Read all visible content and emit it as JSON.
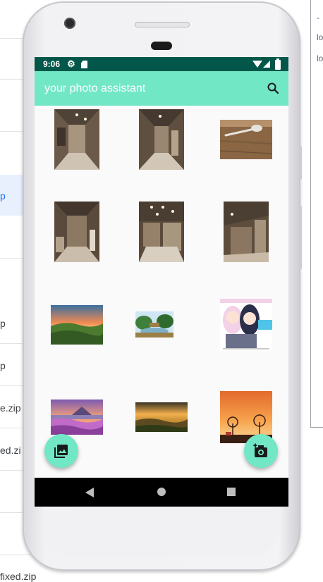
{
  "background": {
    "list_items": [
      {
        "label": "p"
      },
      {
        "label": "p"
      },
      {
        "label": "p"
      },
      {
        "label": "e.zip"
      },
      {
        "label": "ed.zi"
      },
      {
        "label": "fixed.zip"
      }
    ],
    "side_panel": {
      "lines": [
        "-",
        "lo",
        "lo"
      ]
    }
  },
  "status_bar": {
    "time": "9:06",
    "icons": [
      "gear-icon",
      "sd-card-icon",
      "wifi-icon",
      "signal-icon",
      "battery-icon"
    ]
  },
  "app_bar": {
    "title": "your photo assistant",
    "search_icon": "search-icon"
  },
  "gallery": {
    "photos": [
      {
        "name": "photo-room-hallway-1",
        "colors": [
          "#6b5a49",
          "#a89580",
          "#cfc4b4"
        ]
      },
      {
        "name": "photo-room-hallway-2",
        "colors": [
          "#5f4f40",
          "#9a8771",
          "#d2c6b6"
        ]
      },
      {
        "name": "photo-spoon-on-table",
        "colors": [
          "#7a5a3c",
          "#b5906a",
          "#e7e3dc"
        ]
      },
      {
        "name": "photo-room-hallway-3",
        "colors": [
          "#5a4a3b",
          "#8c7963",
          "#cabdab"
        ]
      },
      {
        "name": "photo-kitchen-ceiling-lights",
        "colors": [
          "#5b4a3b",
          "#958169",
          "#d8cfc1"
        ]
      },
      {
        "name": "photo-room-corner",
        "colors": [
          "#5e4d3d",
          "#8b7761",
          "#c8baa6"
        ]
      },
      {
        "name": "photo-sunset-valley",
        "colors": [
          "#f28a52",
          "#3b6f9f",
          "#4c7b2f"
        ]
      },
      {
        "name": "photo-garden-pond",
        "colors": [
          "#cfe6f3",
          "#3e7f3a",
          "#9b7f45"
        ]
      },
      {
        "name": "photo-anime-poster",
        "colors": [
          "#f3d1e6",
          "#2c2f4a",
          "#4fc3e8"
        ]
      },
      {
        "name": "photo-lavender-field-mountain",
        "colors": [
          "#7d5bb0",
          "#c16bc9",
          "#f2a07c"
        ]
      },
      {
        "name": "photo-golden-hills",
        "colors": [
          "#f2b04d",
          "#5c4a20",
          "#2f3a16"
        ]
      },
      {
        "name": "photo-orange-sky-trees",
        "colors": [
          "#f7a24b",
          "#e26a2c",
          "#3a1f14"
        ]
      }
    ]
  },
  "fabs": {
    "gallery_button": "gallery-icon",
    "camera_button": "add-camera-icon"
  },
  "navigation": {
    "back": "back-icon",
    "home": "home-icon",
    "recents": "recents-icon"
  }
}
